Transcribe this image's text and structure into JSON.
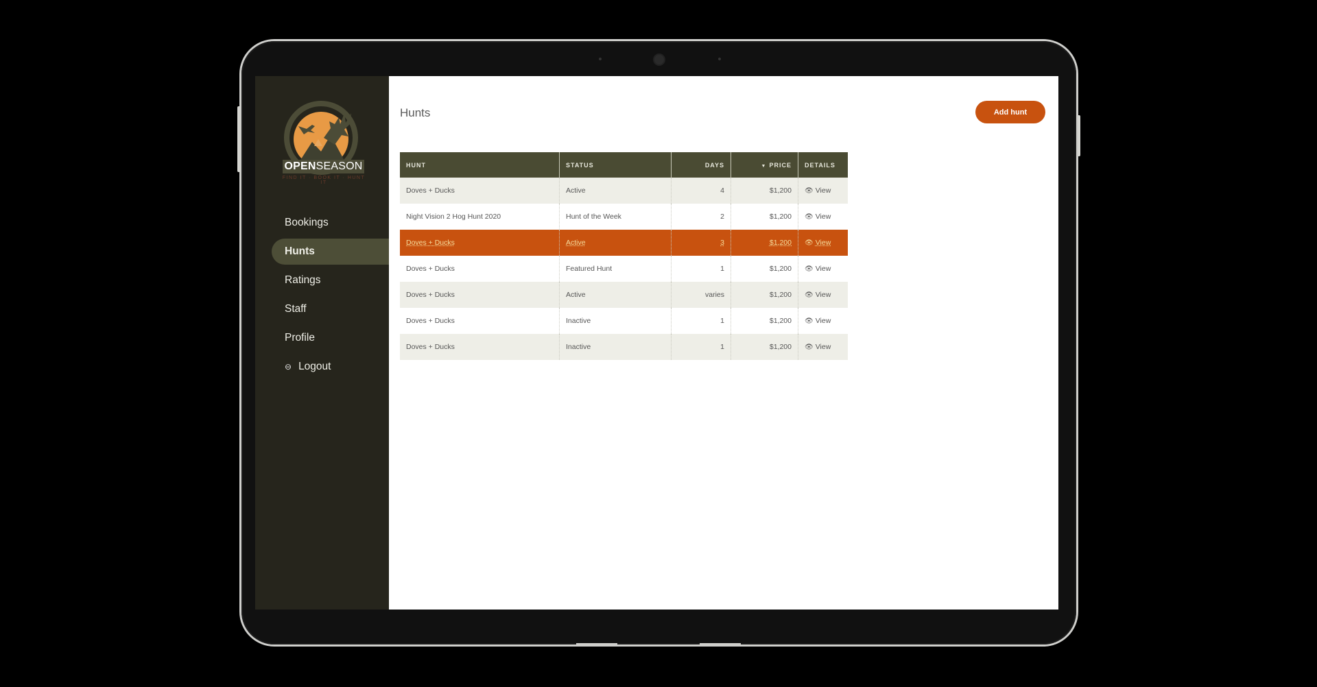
{
  "brand": {
    "name_bold": "OPEN",
    "name_rest": "SEASON",
    "tagline": "FIND IT · BOOK IT · HUNT IT"
  },
  "sidebar": {
    "items": [
      {
        "label": "Bookings",
        "active": false
      },
      {
        "label": "Hunts",
        "active": true
      },
      {
        "label": "Ratings",
        "active": false
      },
      {
        "label": "Staff",
        "active": false
      },
      {
        "label": "Profile",
        "active": false
      },
      {
        "label": "Logout",
        "active": false,
        "icon": "logout-icon"
      }
    ]
  },
  "header": {
    "title": "Hunts",
    "add_button": "Add hunt"
  },
  "table": {
    "columns": [
      "HUNT",
      "STATUS",
      "DAYS",
      "PRICE",
      "DETAILS"
    ],
    "sorted_column": "PRICE",
    "sort_direction": "descending",
    "view_label": "View",
    "rows": [
      {
        "hunt": "Doves + Ducks",
        "status": "Active",
        "days": "4",
        "price": "$1,200"
      },
      {
        "hunt": "Night Vision 2 Hog Hunt 2020",
        "status": "Hunt of the Week",
        "days": "2",
        "price": "$1,200"
      },
      {
        "hunt": "Doves + Ducks",
        "status": "Active",
        "days": "3",
        "price": "$1,200",
        "selected": true
      },
      {
        "hunt": "Doves + Ducks",
        "status": "Featured Hunt",
        "days": "1",
        "price": "$1,200"
      },
      {
        "hunt": "Doves + Ducks",
        "status": "Active",
        "days": "varies",
        "price": "$1,200"
      },
      {
        "hunt": "Doves + Ducks",
        "status": "Inactive",
        "days": "1",
        "price": "$1,200"
      },
      {
        "hunt": "Doves + Ducks",
        "status": "Inactive",
        "days": "1",
        "price": "$1,200"
      }
    ]
  },
  "colors": {
    "accent": "#c8520f",
    "header": "#4a4b33",
    "sidebar": "#26251c",
    "sidebar_active": "#4d4e37",
    "stripe": "#eeeee7"
  }
}
